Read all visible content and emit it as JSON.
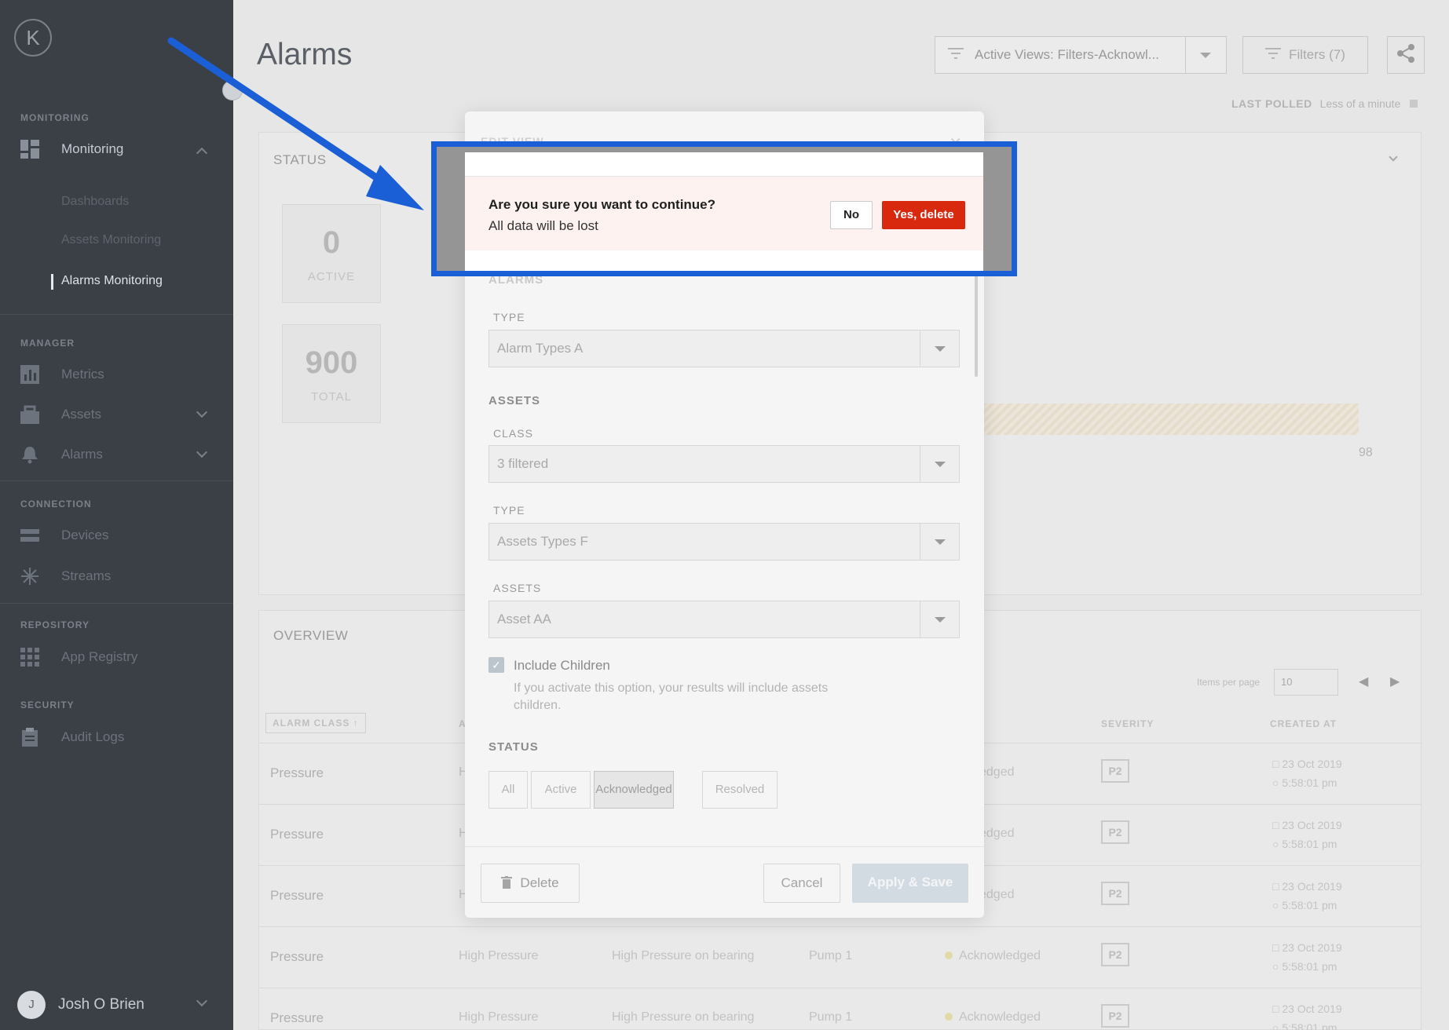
{
  "app": {
    "logo_letter": "K",
    "user_initial": "J",
    "user_name": "Josh O Brien"
  },
  "sidebar": {
    "sections": [
      {
        "title": "MONITORING"
      },
      {
        "title": "MANAGER"
      },
      {
        "title": "CONNECTION"
      },
      {
        "title": "REPOSITORY"
      },
      {
        "title": "SECURITY"
      }
    ],
    "items": {
      "monitoring": "Monitoring",
      "sub1": "Dashboards",
      "sub2": "Assets Monitoring",
      "sub3": "Alarms Monitoring",
      "metrics": "Metrics",
      "assets": "Assets",
      "alarms": "Alarms",
      "devices": "Devices",
      "streams": "Streams",
      "app_registry": "App Registry",
      "audit_logs": "Audit Logs"
    }
  },
  "header": {
    "title": "Alarms",
    "active_view": "Active Views: Filters-Acknowl...",
    "filters_label": "Filters (7)",
    "last_polled_label": "LAST POLLED",
    "last_polled_value": "Less of a minute"
  },
  "status_panel": {
    "title": "STATUS",
    "active_count": "0",
    "active_label": "ACTIVE",
    "total_count": "900",
    "total_label": "TOTAL",
    "bar_value": "98"
  },
  "overview": {
    "title": "OVERVIEW",
    "items_per_page_label": "Items per page",
    "items_per_page": "10",
    "columns": {
      "alarm_class": "ALARM CLASS",
      "col2": "A",
      "severity": "SEVERITY",
      "created_at": "CREATED AT"
    },
    "rows": [
      {
        "class": "Pressure",
        "type": "H",
        "desc": "",
        "asset": "",
        "state": "owledged",
        "severity": "P2",
        "date": "23 Oct 2019",
        "time": "5:58:01 pm"
      },
      {
        "class": "Pressure",
        "type": "H",
        "desc": "",
        "asset": "",
        "state": "owledged",
        "severity": "P2",
        "date": "23 Oct 2019",
        "time": "5:58:01 pm"
      },
      {
        "class": "Pressure",
        "type": "H",
        "desc": "",
        "asset": "",
        "state": "owledged",
        "severity": "P2",
        "date": "23 Oct 2019",
        "time": "5:58:01 pm"
      },
      {
        "class": "Pressure",
        "type": "High Pressure",
        "desc": "High Pressure on bearing",
        "asset": "Pump 1",
        "state": "Acknowledged",
        "severity": "P2",
        "date": "23 Oct 2019",
        "time": "5:58:01 pm"
      },
      {
        "class": "Pressure",
        "type": "High Pressure",
        "desc": "High Pressure on bearing",
        "asset": "Pump 1",
        "state": "Acknowledged",
        "severity": "P2",
        "date": "23 Oct 2019",
        "time": "5:58:01 pm"
      }
    ]
  },
  "modal": {
    "header": "EDIT VIEW",
    "alarms_section": "ALARMS",
    "alarms_type_label": "TYPE",
    "alarms_type_value": "Alarm Types A",
    "assets_section": "ASSETS",
    "class_label": "CLASS",
    "class_value": "3 filtered",
    "assets_type_label": "TYPE",
    "assets_type_value": "Assets Types F",
    "assets_label": "ASSETS",
    "assets_value": "Asset AA",
    "include_children_label": "Include Children",
    "include_children_help": "If you activate this option, your results will include assets children.",
    "status_section": "STATUS",
    "status_options": [
      "All",
      "Active",
      "Acknowledged",
      "Resolved"
    ],
    "status_selected": "Acknowledged",
    "delete_label": "Delete",
    "cancel_label": "Cancel",
    "apply_label": "Apply & Save"
  },
  "confirm": {
    "question": "Are you sure you want to continue?",
    "subtext": "All data will be lost",
    "no_label": "No",
    "yes_label": "Yes, delete"
  },
  "colors": {
    "highlight": "#1b5fd6",
    "danger": "#d8290f",
    "confirm_bg": "#fdf2f0"
  }
}
